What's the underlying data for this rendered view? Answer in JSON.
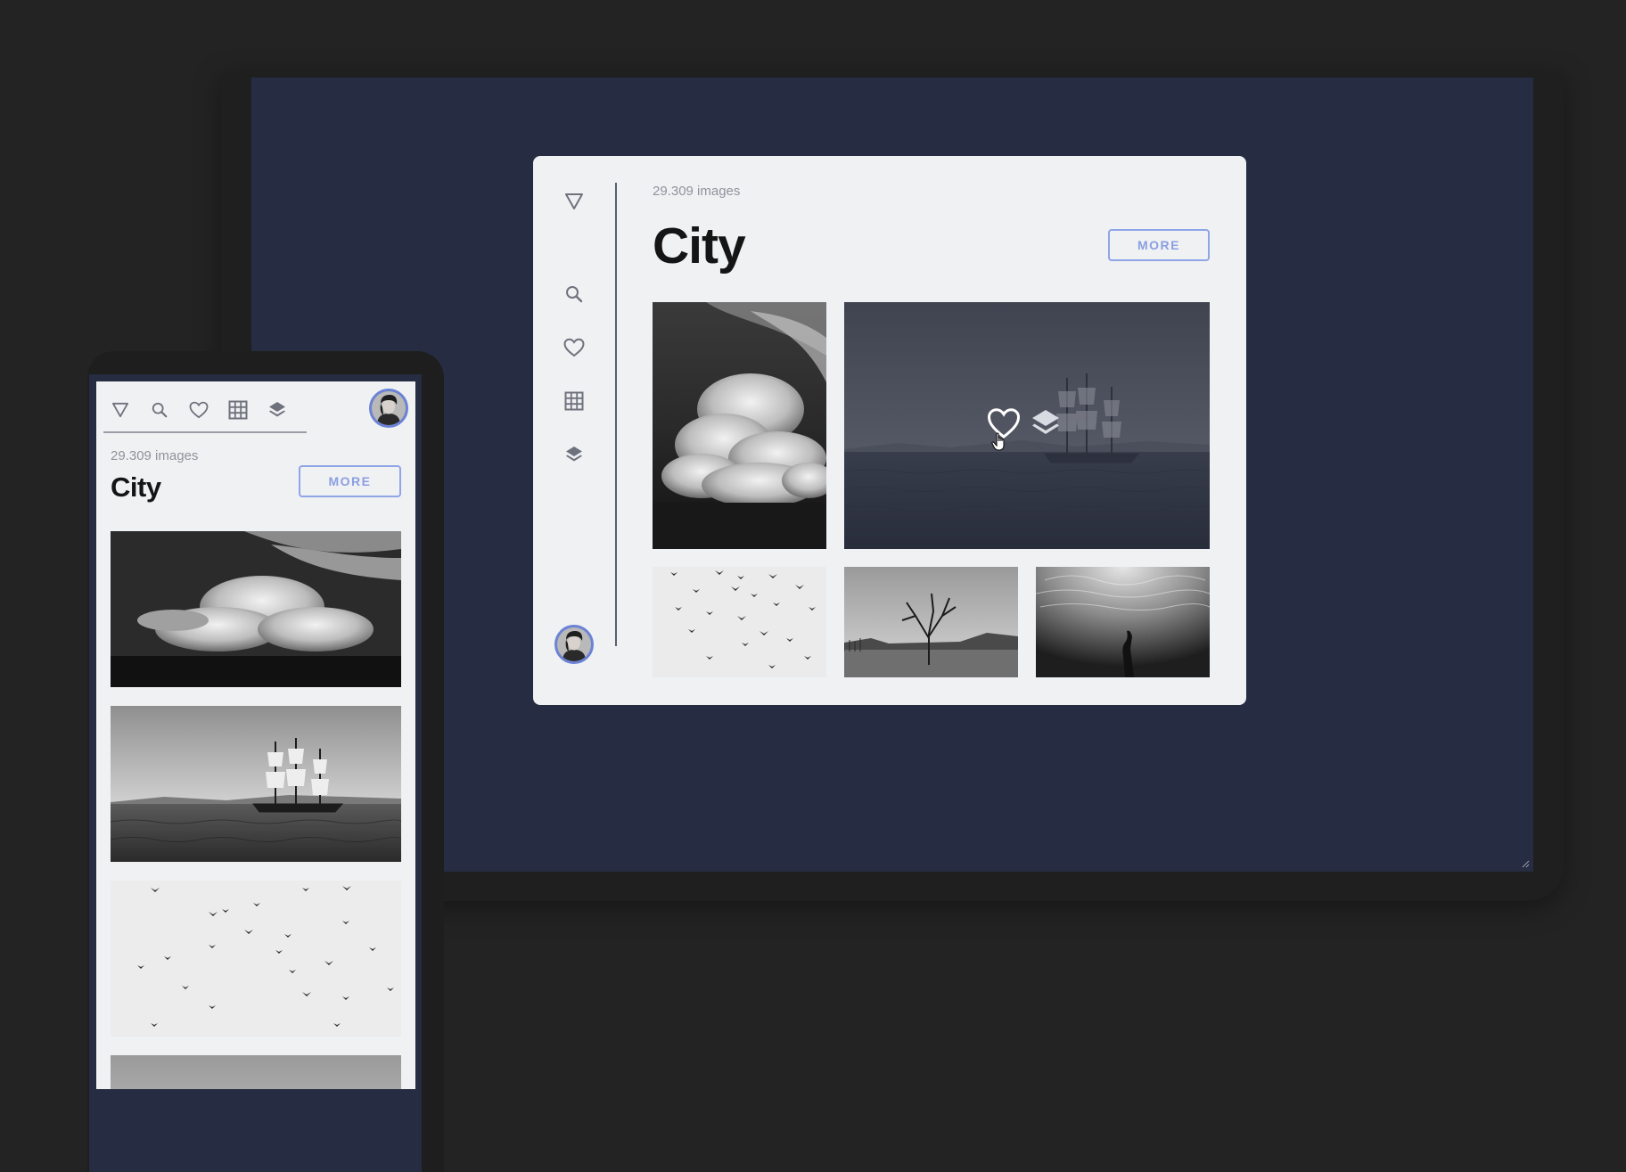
{
  "gallery": {
    "count": "29.309 images",
    "title": "City",
    "more_label": "MORE"
  },
  "nav_icons": [
    "filter-icon",
    "search-icon",
    "heart-icon",
    "grid-icon",
    "layers-icon"
  ],
  "tiles": [
    "clouds",
    "sailing-ship",
    "birds",
    "lone-tree",
    "underwater-swimmer"
  ],
  "colors": {
    "background": "#232323",
    "screen": "#262c41",
    "card": "#f0f1f3",
    "accent": "#8a9fe2",
    "title": "#151515",
    "muted": "#8f939c"
  }
}
